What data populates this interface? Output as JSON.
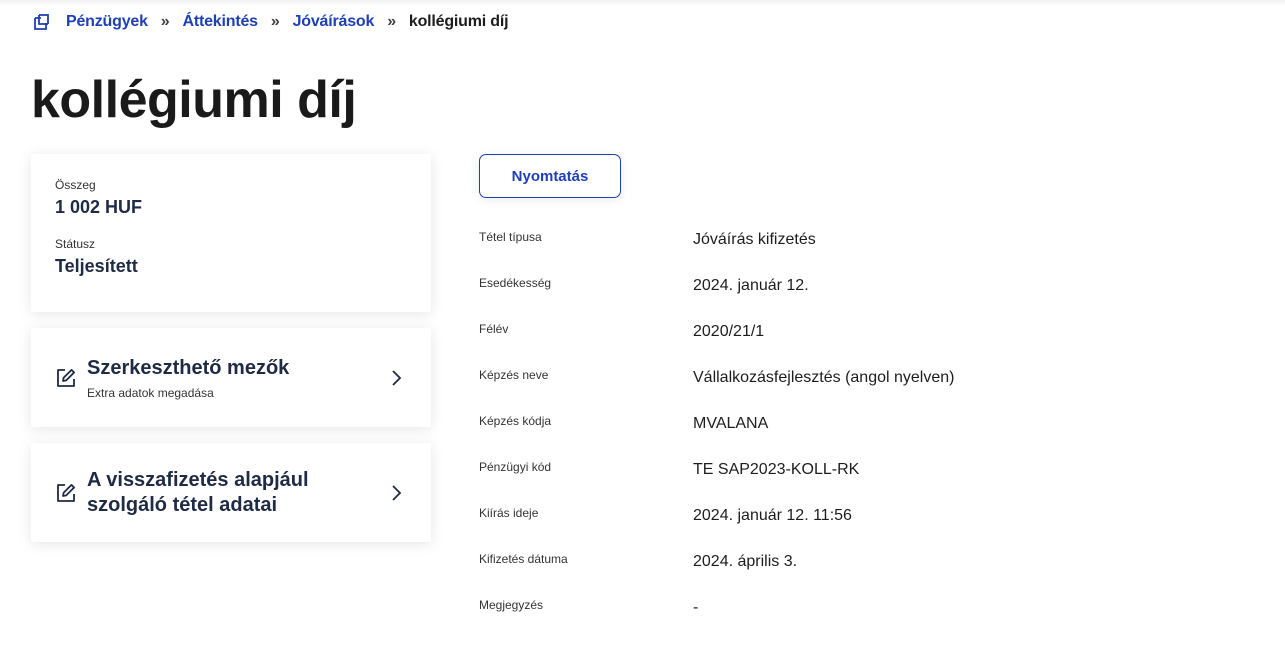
{
  "breadcrumb": {
    "icon": "external-link-icon",
    "items": [
      "Pénzügyek",
      "Áttekintés",
      "Jóváírások"
    ],
    "current": "kollégiumi díj",
    "separator": "»"
  },
  "page": {
    "title": "kollégiumi díj"
  },
  "summary": {
    "amount_label": "Összeg",
    "amount_value": "1 002 HUF",
    "status_label": "Státusz",
    "status_value": "Teljesített"
  },
  "cards": [
    {
      "title": "Szerkeszthető mezők",
      "subtitle": "Extra adatok megadása",
      "icon": "edit-icon"
    },
    {
      "title_line1": "A visszafizetés alapjául",
      "title_line2": "szolgáló tétel adatai",
      "icon": "edit-icon"
    }
  ],
  "print_button": "Nyomtatás",
  "details": [
    {
      "label": "Tétel típusa",
      "value": "Jóváírás kifizetés"
    },
    {
      "label": "Esedékesség",
      "value": "2024. január 12."
    },
    {
      "label": "Félév",
      "value": "2020/21/1"
    },
    {
      "label": "Képzés neve",
      "value": "Vállalkozásfejlesztés (angol nyelven)"
    },
    {
      "label": "Képzés kódja",
      "value": "MVALANA"
    },
    {
      "label": "Pénzügyi kód",
      "value": "TE SAP2023-KOLL-RK"
    },
    {
      "label": "Kiírás ideje",
      "value": "2024. január 12. 11:56"
    },
    {
      "label": "Kifizetés dátuma",
      "value": "2024. április 3."
    },
    {
      "label": "Megjegyzés",
      "value": "-"
    }
  ],
  "colors": {
    "link": "#1f3fb5",
    "heading": "#1f2a44"
  }
}
